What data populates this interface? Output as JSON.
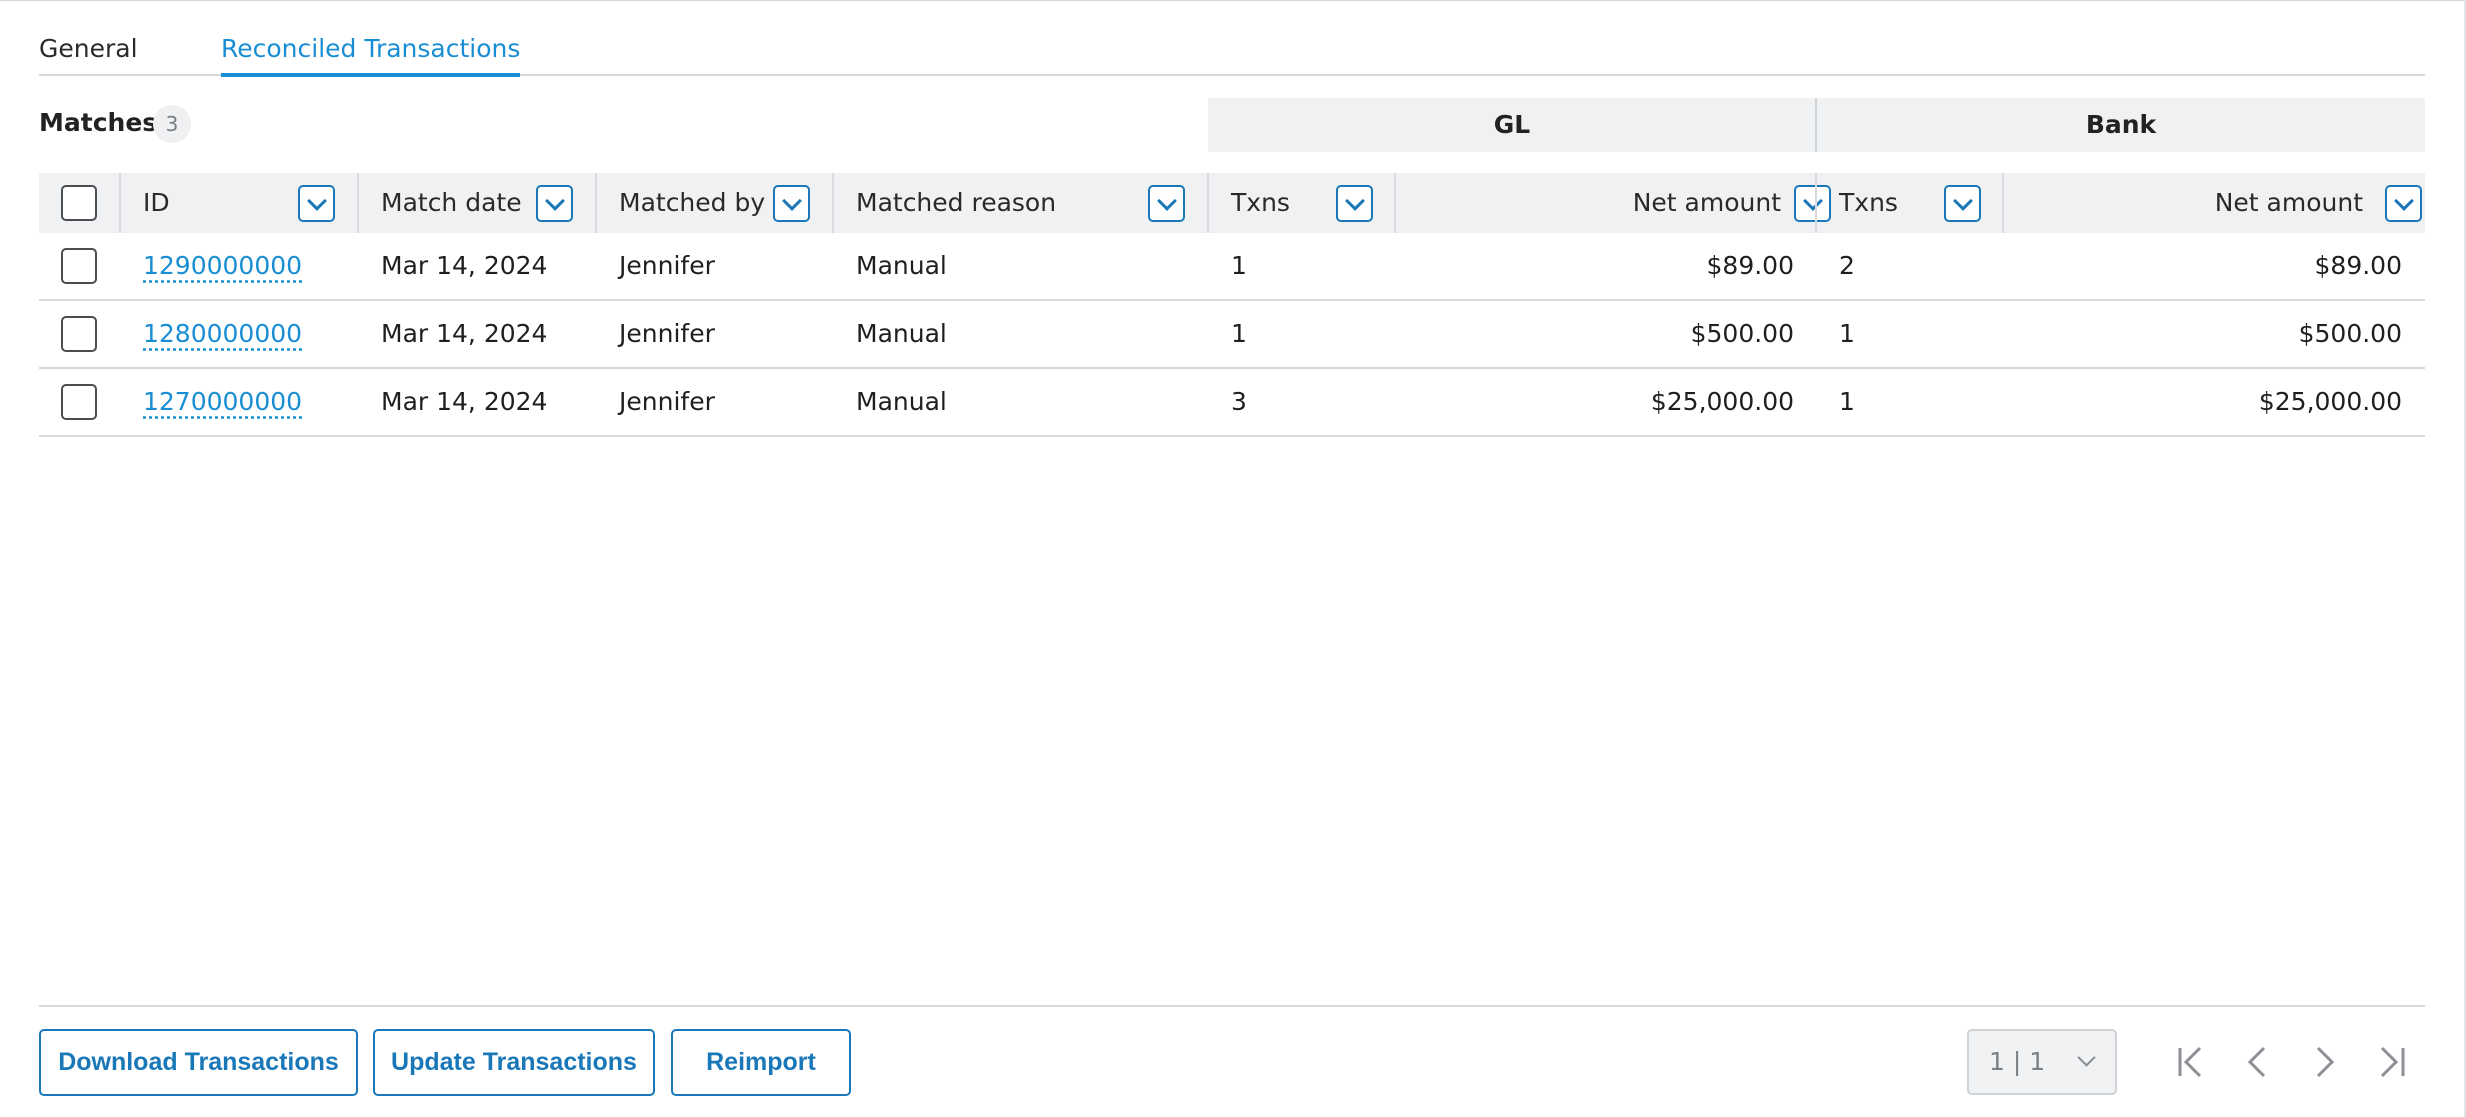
{
  "tabs": [
    {
      "label": "General",
      "active": false
    },
    {
      "label": "Reconciled Transactions",
      "active": true
    }
  ],
  "matches": {
    "title": "Matches",
    "count": "3"
  },
  "groups": {
    "gl": "GL",
    "bank": "Bank"
  },
  "columns": {
    "id": "ID",
    "match_date": "Match date",
    "matched_by": "Matched by",
    "matched_reason": "Matched reason",
    "gl_txns": "Txns",
    "gl_net_amount": "Net amount",
    "bank_txns": "Txns",
    "bank_net_amount": "Net amount"
  },
  "rows": [
    {
      "id": "1290000000",
      "match_date": "Mar 14, 2024",
      "matched_by": "Jennifer",
      "matched_reason": "Manual",
      "gl_txns": "1",
      "gl_net_amount": "$89.00",
      "bank_txns": "2",
      "bank_net_amount": "$89.00"
    },
    {
      "id": "1280000000",
      "match_date": "Mar 14, 2024",
      "matched_by": "Jennifer",
      "matched_reason": "Manual",
      "gl_txns": "1",
      "gl_net_amount": "$500.00",
      "bank_txns": "1",
      "bank_net_amount": "$500.00"
    },
    {
      "id": "1270000000",
      "match_date": "Mar 14, 2024",
      "matched_by": "Jennifer",
      "matched_reason": "Manual",
      "gl_txns": "3",
      "gl_net_amount": "$25,000.00",
      "bank_txns": "1",
      "bank_net_amount": "$25,000.00"
    }
  ],
  "footer": {
    "download_label": "Download Transactions",
    "update_label": "Update Transactions",
    "reimport_label": "Reimport",
    "page_indicator": "1 | 1"
  },
  "colors": {
    "accent": "#1a8ed4",
    "button_border": "#1a78b8",
    "header_bg": "#f0f1f3"
  }
}
